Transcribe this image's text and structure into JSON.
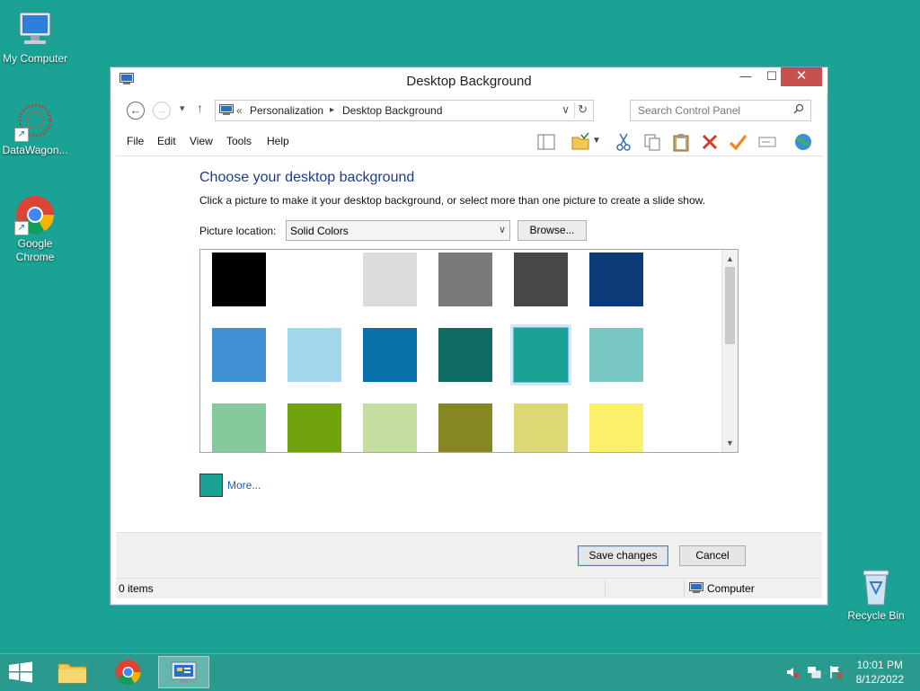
{
  "desktop": {
    "icons": [
      {
        "label": "My Computer"
      },
      {
        "label": "DataWagon..."
      },
      {
        "label": "Google Chrome"
      },
      {
        "label": "Recycle Bin"
      }
    ]
  },
  "window": {
    "title": "Desktop Background",
    "controls": {
      "minimize": "—",
      "maximize": "☐",
      "close": "✕"
    },
    "nav": {
      "back": "←",
      "forward": "→",
      "recent": "▾",
      "up": "↑",
      "breadcrumb_prefix": "«",
      "breadcrumbs": [
        "Personalization",
        "Desktop Background"
      ],
      "crumb_sep": "▸",
      "dropdown": "∨",
      "refresh": "↻"
    },
    "search": {
      "placeholder": "Search Control Panel",
      "icon": "search-icon"
    },
    "menu": [
      "File",
      "Edit",
      "View",
      "Tools",
      "Help"
    ],
    "heading": "Choose your desktop background",
    "subtext": "Click a picture to make it your desktop background, or select more than one picture to create a slide show.",
    "picture_location": {
      "label": "Picture location:",
      "value": "Solid Colors",
      "arrow": "∨"
    },
    "browse_label": "Browse...",
    "swatches": [
      "#000000",
      "#ffffff",
      "#dcdcdc",
      "#7a7a7a",
      "#474747",
      "#0b3a78",
      "#3f8fd2",
      "#a1d8ec",
      "#0770a8",
      "#0e6b64",
      "#1aa394",
      "#79c8c4",
      "#86c99d",
      "#6fa20b",
      "#c4dea0",
      "#868722",
      "#dcd974",
      "#fcf06a"
    ],
    "selected_swatch": 10,
    "scroll": {
      "up": "▲",
      "down": "▼"
    },
    "more": {
      "label": "More...",
      "color": "#1aa394"
    },
    "buttons": {
      "save": "Save changes",
      "cancel": "Cancel"
    },
    "status": {
      "items": "0 items",
      "location": "Computer"
    }
  },
  "taskbar": {
    "clock_time": "10:01 PM",
    "clock_date": "8/12/2022",
    "accent": "#2a9a8e"
  }
}
